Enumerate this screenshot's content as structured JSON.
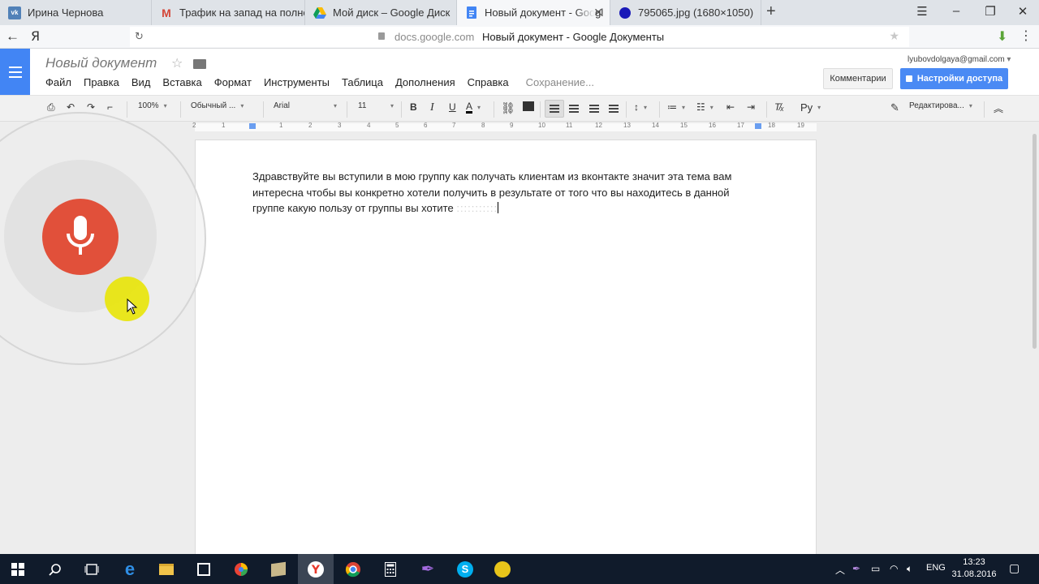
{
  "browser": {
    "tabs": [
      {
        "label": "Ирина Чернова",
        "favicon": "vk-icon"
      },
      {
        "label": "Трафик на запад на полно",
        "favicon": "gmail-icon"
      },
      {
        "label": "Мой диск – Google Диск",
        "favicon": "google-drive-icon"
      },
      {
        "label": "Новый документ - Googl",
        "favicon": "google-docs-icon"
      },
      {
        "label": "795065.jpg (1680×1050)",
        "favicon": "image-icon"
      }
    ],
    "new_tab": "+",
    "yandex_logo": "Я",
    "url_domain": "docs.google.com",
    "page_title": "Новый документ - Google Документы"
  },
  "docs": {
    "title": "Новый документ",
    "menu": [
      "Файл",
      "Правка",
      "Вид",
      "Вставка",
      "Формат",
      "Инструменты",
      "Таблица",
      "Дополнения",
      "Справка"
    ],
    "saving_status": "Сохранение...",
    "account_email": "lyubovdolgaya@gmail.com",
    "comments_button": "Комментарии",
    "share_button": "Настройки доступа"
  },
  "toolbar": {
    "zoom": "100%",
    "style": "Обычный ...",
    "font": "Arial",
    "size": "11",
    "bold": "B",
    "italic": "I",
    "underline": "U",
    "text_color": "A",
    "input_tools": "Ру",
    "mode": "Редактирова..."
  },
  "ruler": {
    "ticks": [
      "2",
      "1",
      "1",
      "2",
      "3",
      "4",
      "5",
      "6",
      "7",
      "8",
      "9",
      "10",
      "11",
      "12",
      "13",
      "14",
      "15",
      "16",
      "17",
      "18",
      "19"
    ]
  },
  "document": {
    "text": "Здравствуйте вы вступили в мою группу как получать клиентам из вконтакте значит эта тема вам интересна чтобы вы конкретно хотели получить в результате от того что вы находитесь в данной группе какую пользу от группы вы хотите",
    "interim": ":::::::::::"
  },
  "taskbar": {
    "language": "ENG",
    "time": "13:23",
    "date": "31.08.2016"
  },
  "colors": {
    "docs_blue": "#4285f4",
    "share_blue": "#4a8af4",
    "mic_red": "#e1503a",
    "cursor_highlight": "#e8e500",
    "taskbar": "#101b2b"
  }
}
